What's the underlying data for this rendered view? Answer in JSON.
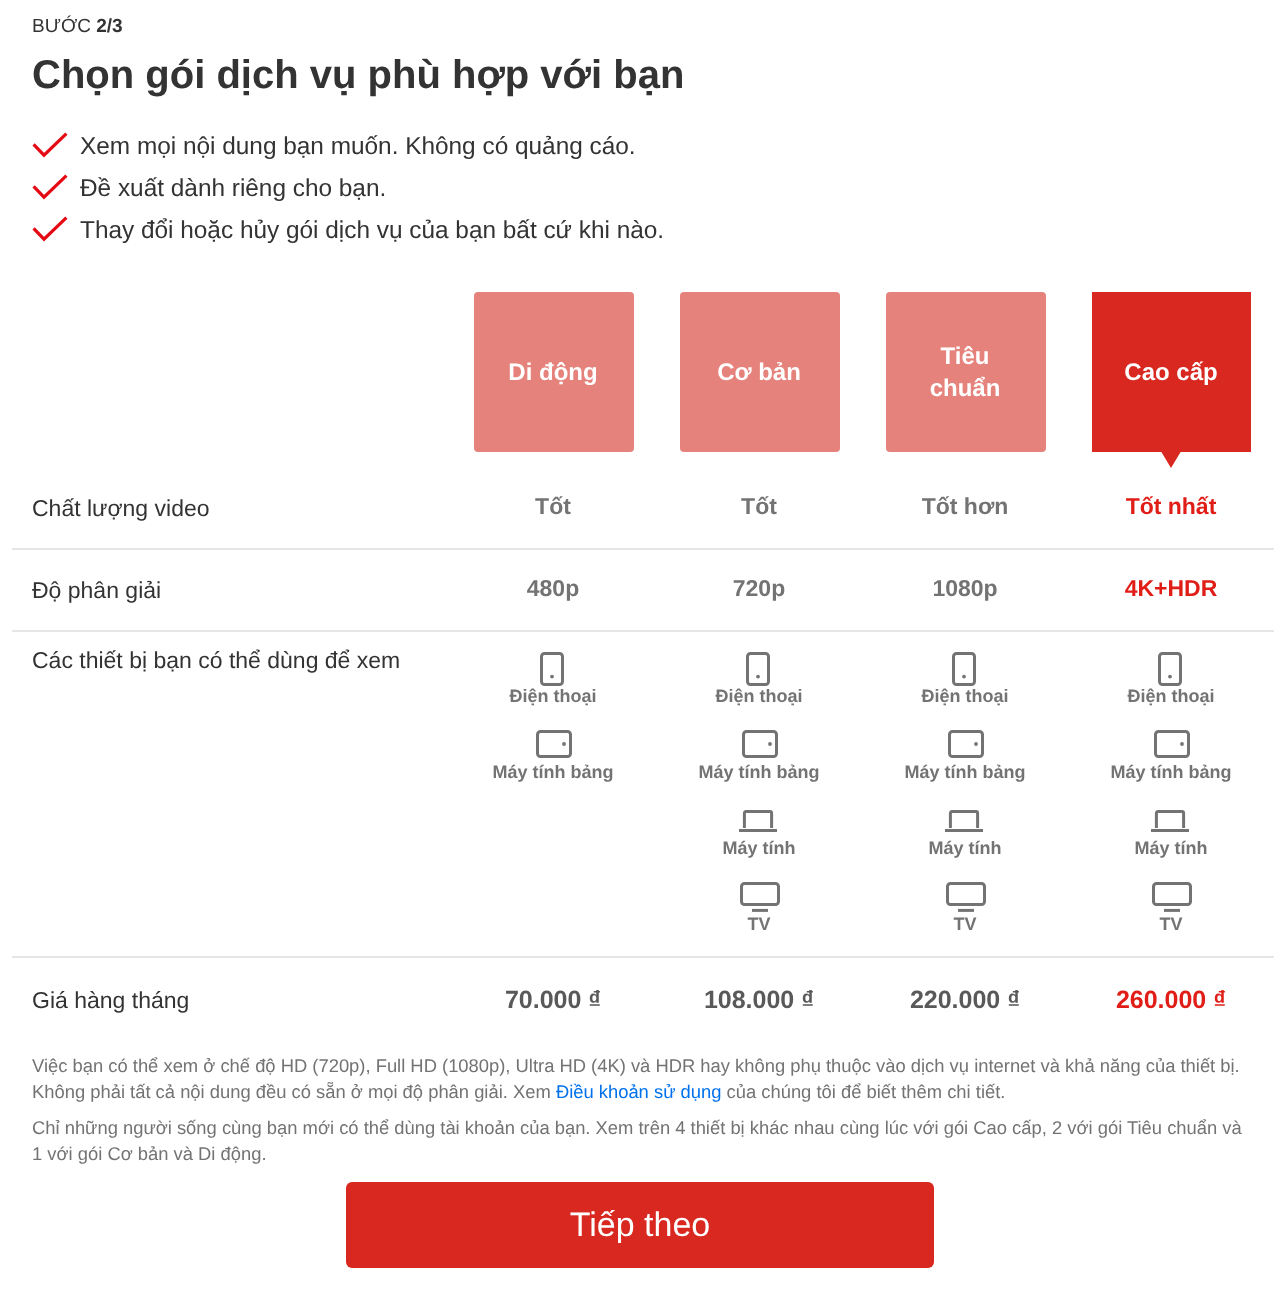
{
  "step": "BƯỚC **2/3**",
  "title": "Chọn gói dịch vụ phù hợp với bạn",
  "benefits": [
    "Xem mọi nội dung bạn muốn. Không có quảng cáo.",
    "Đề xuất dành riêng cho bạn.",
    "Thay đổi hoặc hủy gói dịch vụ của bạn bất cứ khi nào."
  ],
  "plans": [
    {
      "name": "Di động",
      "selected": false
    },
    {
      "name": "Cơ bản",
      "selected": false
    },
    {
      "name": "Tiêu chuẩn",
      "selected": false
    },
    {
      "name": "Cao cấp",
      "selected": true
    }
  ],
  "rows": [
    {
      "kind": "text",
      "label": "Chất lượng video",
      "cells": [
        "Tốt",
        "Tốt",
        "Tốt hơn",
        "Tốt nhất"
      ]
    },
    {
      "kind": "text",
      "label": "Độ phân giải",
      "cells": [
        "480p",
        "720p",
        "1080p",
        "4K+HDR"
      ]
    },
    {
      "kind": "devices",
      "label": "Các thiết bị bạn có thể dùng để xem",
      "cells": [
        [
          {
            "kind": "phone",
            "name": "Điện thoại"
          },
          {
            "kind": "tablet",
            "name": "Máy tính bảng"
          }
        ],
        [
          {
            "kind": "phone",
            "name": "Điện thoại"
          },
          {
            "kind": "tablet",
            "name": "Máy tính bảng"
          },
          {
            "kind": "computer",
            "name": "Máy tính"
          },
          {
            "kind": "tv",
            "name": "TV"
          }
        ],
        [
          {
            "kind": "phone",
            "name": "Điện thoại"
          },
          {
            "kind": "tablet",
            "name": "Máy tính bảng"
          },
          {
            "kind": "computer",
            "name": "Máy tính"
          },
          {
            "kind": "tv",
            "name": "TV"
          }
        ],
        [
          {
            "kind": "phone",
            "name": "Điện thoại"
          },
          {
            "kind": "tablet",
            "name": "Máy tính bảng"
          },
          {
            "kind": "computer",
            "name": "Máy tính"
          },
          {
            "kind": "tv",
            "name": "TV"
          }
        ]
      ]
    },
    {
      "kind": "price",
      "label": "Giá hàng tháng",
      "cells": [
        "70.000 ₫",
        "108.000 ₫",
        "220.000 ₫",
        "260.000 ₫"
      ]
    }
  ],
  "notes": [
    {
      "before": "Việc bạn có thể xem ở chế độ HD (720p), Full HD (1080p), Ultra HD (4K) và HDR hay không phụ thuộc vào dịch vụ internet và khả năng của thiết bị. Không phải tất cả nội dung đều có sẵn ở mọi độ phân giải. Xem",
      "link": "Điều khoản sử dụng",
      "after": "của chúng tôi để biết thêm chi tiết."
    },
    {
      "before": "Chỉ những người sống cùng bạn mới có thể dùng tài khoản của bạn. Xem trên 4 thiết bị khác nhau cùng lúc với gói Cao cấp, 2 với gói Tiêu chuẩn và 1 với gói Cơ bản và Di động."
    }
  ],
  "button": "Tiếp theo"
}
